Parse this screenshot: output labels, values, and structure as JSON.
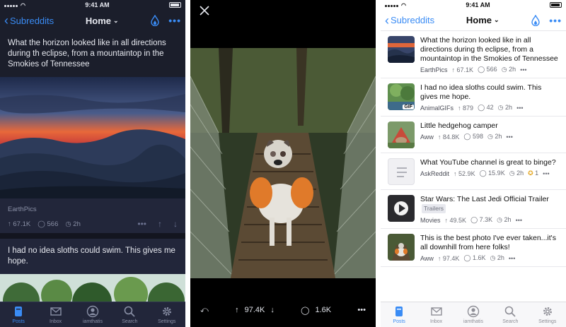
{
  "status_time": "9:41 AM",
  "nav": {
    "back_label": "Subreddits",
    "title": "Home",
    "more": "•••"
  },
  "dark_feed": {
    "post1": {
      "title": "What the horizon looked like in all directions during th eclipse, from a mountaintop in the Smokies of Tennessee",
      "subreddit": "EarthPics",
      "upvotes": "67.1K",
      "comments": "566",
      "age": "2h",
      "more": "•••"
    },
    "post2": {
      "title": "I had no idea sloths could swim. This gives me hope."
    }
  },
  "viewer": {
    "upvotes": "97.4K",
    "comments": "1.6K",
    "more": "•••"
  },
  "light_list": {
    "items": [
      {
        "title": "What the horizon looked like in all directions during th eclipse, from a mountaintop in the Smokies of Tennessee",
        "subreddit": "EarthPics",
        "upvotes": "67.1K",
        "comments": "566",
        "age": "2h",
        "more": "•••",
        "thumb": "sunset-mountains"
      },
      {
        "title": "I had no idea sloths could swim. This gives me hope.",
        "subreddit": "AnimalGIFs",
        "upvotes": "879",
        "comments": "42",
        "age": "2h",
        "more": "•••",
        "thumb": "sloth",
        "badge": "GIF"
      },
      {
        "title": "Little hedgehog camper",
        "subreddit": "Aww",
        "upvotes": "84.8K",
        "comments": "598",
        "age": "2h",
        "more": "•••",
        "thumb": "hedgehog"
      },
      {
        "title": "What YouTube channel is great to binge?",
        "subreddit": "AskReddit",
        "upvotes": "52.9K",
        "comments": "15.9K",
        "age": "2h",
        "gold": "1",
        "more": "•••",
        "thumb": "text-post"
      },
      {
        "title": "Star Wars: The Last Jedi Official Trailer",
        "flair": "Trailers",
        "subreddit": "Movies",
        "upvotes": "49.5K",
        "comments": "7.3K",
        "age": "2h",
        "more": "•••",
        "thumb": "video"
      },
      {
        "title": "This is the best photo I've ever taken...it's all downhill from here folks!",
        "subreddit": "Aww",
        "upvotes": "97.4K",
        "comments": "1.6K",
        "age": "2h",
        "more": "•••",
        "thumb": "dog-bridge"
      }
    ]
  },
  "tabs": [
    "Posts",
    "Inbox",
    "iamthatis",
    "Search",
    "Settings"
  ],
  "colors": {
    "accent": "#3a8cf5",
    "dark_bg": "#1b1e2b",
    "gold": "#e3a51f"
  }
}
